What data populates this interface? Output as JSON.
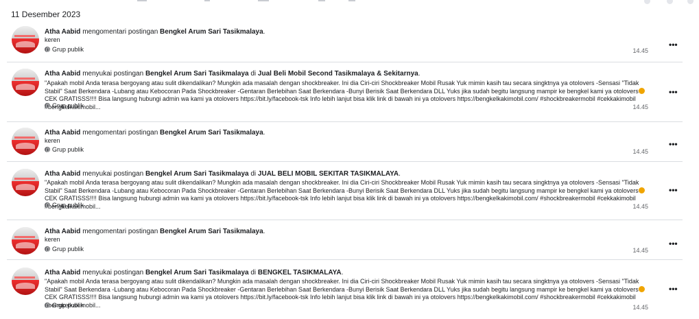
{
  "date": "11 Desember 2023",
  "entries": [
    {
      "actor": "Atha Aabid",
      "verb": " mengomentari postingan ",
      "target": "Bengkel Arum Sari Tasikmalaya",
      "suffix": ".",
      "comment": "keren",
      "privacy": "Grup publik",
      "time": "14.45"
    },
    {
      "actor": "Atha Aabid",
      "verb": " menyukai postingan ",
      "target": "Bengkel Arum Sari Tasikmalaya",
      "in": " di ",
      "group": "Jual Beli Mobil Second Tasikmalaya & Sekitarnya",
      "suffix": ".",
      "text_before_emoji": "\"Apakah mobil Anda terasa bergoyang atau sulit dikendalikan? Mungkin ada masalah dengan shockbreaker. Ini dia Ciri-ciri Shockbreaker Mobil Rusak Yuk mimin kasih tau secara singktnya ya otolovers -Sensasi \"Tidak Stabil\" Saat Berkendara -Lubang atau Kebocoran Pada Shockbreaker -Gentaran Berlebihan Saat Berkendara -Bunyi Berisik Saat Berkendara DLL Yuks jika sudah begitu langsung mampir ke bengkel kami ya otolovers",
      "text_after_emoji": " CEK GRATISSS!!!! Bisa langsung hubungi admin wa kami ya otolovers https://bit.ly/facebook-tsk Info lebih lanjut bisa klik link di bawah ini ya otolovers https://bengkelkakimobil.com/ #shockbreakermobil #cekkakimobil #bengkelkakimobil...",
      "privacy": "Grup publik",
      "time": "14.45"
    },
    {
      "actor": "Atha Aabid",
      "verb": " mengomentari postingan ",
      "target": "Bengkel Arum Sari Tasikmalaya",
      "suffix": ".",
      "comment": "keren",
      "privacy": "Grup publik",
      "time": "14.45"
    },
    {
      "actor": "Atha Aabid",
      "verb": " menyukai postingan ",
      "target": "Bengkel Arum Sari Tasikmalaya",
      "in": " di ",
      "group": "JUAL BELI MOBIL SEKITAR TASIKMALAYA",
      "suffix": ".",
      "text_before_emoji": "\"Apakah mobil Anda terasa bergoyang atau sulit dikendalikan? Mungkin ada masalah dengan shockbreaker. Ini dia Ciri-ciri Shockbreaker Mobil Rusak Yuk mimin kasih tau secara singktnya ya otolovers -Sensasi \"Tidak Stabil\" Saat Berkendara -Lubang atau Kebocoran Pada Shockbreaker -Gentaran Berlebihan Saat Berkendara -Bunyi Berisik Saat Berkendara DLL Yuks jika sudah begitu langsung mampir ke bengkel kami ya otolovers",
      "text_after_emoji": " CEK GRATISSS!!!! Bisa langsung hubungi admin wa kami ya otolovers https://bit.ly/facebook-tsk Info lebih lanjut bisa klik link di bawah ini ya otolovers https://bengkelkakimobil.com/ #shockbreakermobil #cekkakimobil #bengkelkakimobil...",
      "privacy": "Grup publik",
      "time": "14.45"
    },
    {
      "actor": "Atha Aabid",
      "verb": " mengomentari postingan ",
      "target": "Bengkel Arum Sari Tasikmalaya",
      "suffix": ".",
      "comment": "keren",
      "privacy": "Grup publik",
      "time": "14.45"
    },
    {
      "actor": "Atha Aabid",
      "verb": " menyukai postingan ",
      "target": "Bengkel Arum Sari Tasikmalaya",
      "in": " di ",
      "group": "BENGKEL TASIKMALAYA",
      "suffix": ".",
      "text_before_emoji": "\"Apakah mobil Anda terasa bergoyang atau sulit dikendalikan? Mungkin ada masalah dengan shockbreaker. Ini dia Ciri-ciri Shockbreaker Mobil Rusak Yuk mimin kasih tau secara singktnya ya otolovers -Sensasi \"Tidak Stabil\" Saat Berkendara -Lubang atau Kebocoran Pada Shockbreaker -Gentaran Berlebihan Saat Berkendara -Bunyi Berisik Saat Berkendara DLL Yuks jika sudah begitu langsung mampir ke bengkel kami ya otolovers",
      "text_after_emoji": " CEK GRATISSS!!!! Bisa langsung hubungi admin wa kami ya otolovers https://bit.ly/facebook-tsk Info lebih lanjut bisa klik link di bawah ini ya otolovers https://bengkelkakimobil.com/ #shockbreakermobil #cekkakimobil #bengkelkakimobil...",
      "privacy": "Grup publik",
      "time": "14.45"
    }
  ],
  "more_label": "•••",
  "colors": {
    "divider": "#dadde1",
    "meta": "#65676b",
    "text": "#1c1e21"
  }
}
